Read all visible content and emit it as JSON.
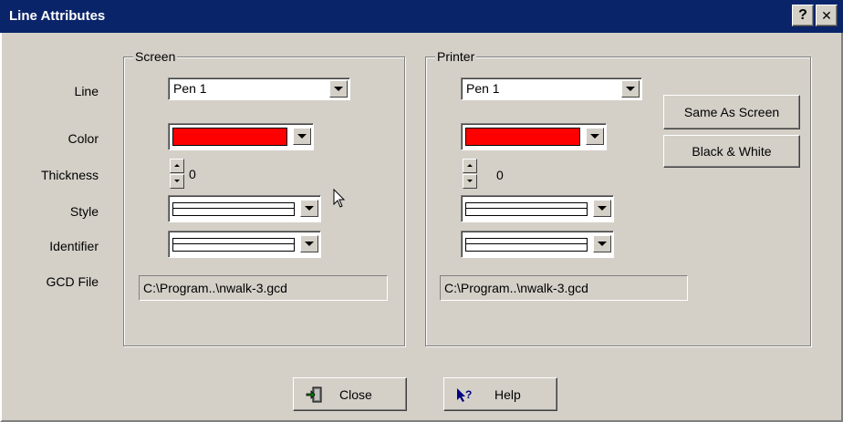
{
  "window": {
    "title": "Line Attributes",
    "help_button": "?",
    "close_button": "✕"
  },
  "labels": {
    "line": "Line",
    "color": "Color",
    "thickness": "Thickness",
    "style": "Style",
    "identifier": "Identifier",
    "gcd_file": "GCD File"
  },
  "screen": {
    "group_label": "Screen",
    "line_value": "Pen 1",
    "color_value": "#ff0000",
    "thickness_value": "0",
    "gcd_file_value": "C:\\Program..\\nwalk-3.gcd"
  },
  "printer": {
    "group_label": "Printer",
    "line_value": "Pen 1",
    "color_value": "#ff0000",
    "thickness_value": "0",
    "gcd_file_value": "C:\\Program..\\nwalk-3.gcd"
  },
  "buttons": {
    "same_as_screen": "Same As Screen",
    "black_white": "Black & White",
    "close": "Close",
    "help": "Help"
  },
  "icons": {
    "close": "exit-door-icon",
    "help": "whats-this-help-icon"
  },
  "colors": {
    "titlebar": "#0a246a",
    "dialog_face": "#d4d0c8"
  }
}
